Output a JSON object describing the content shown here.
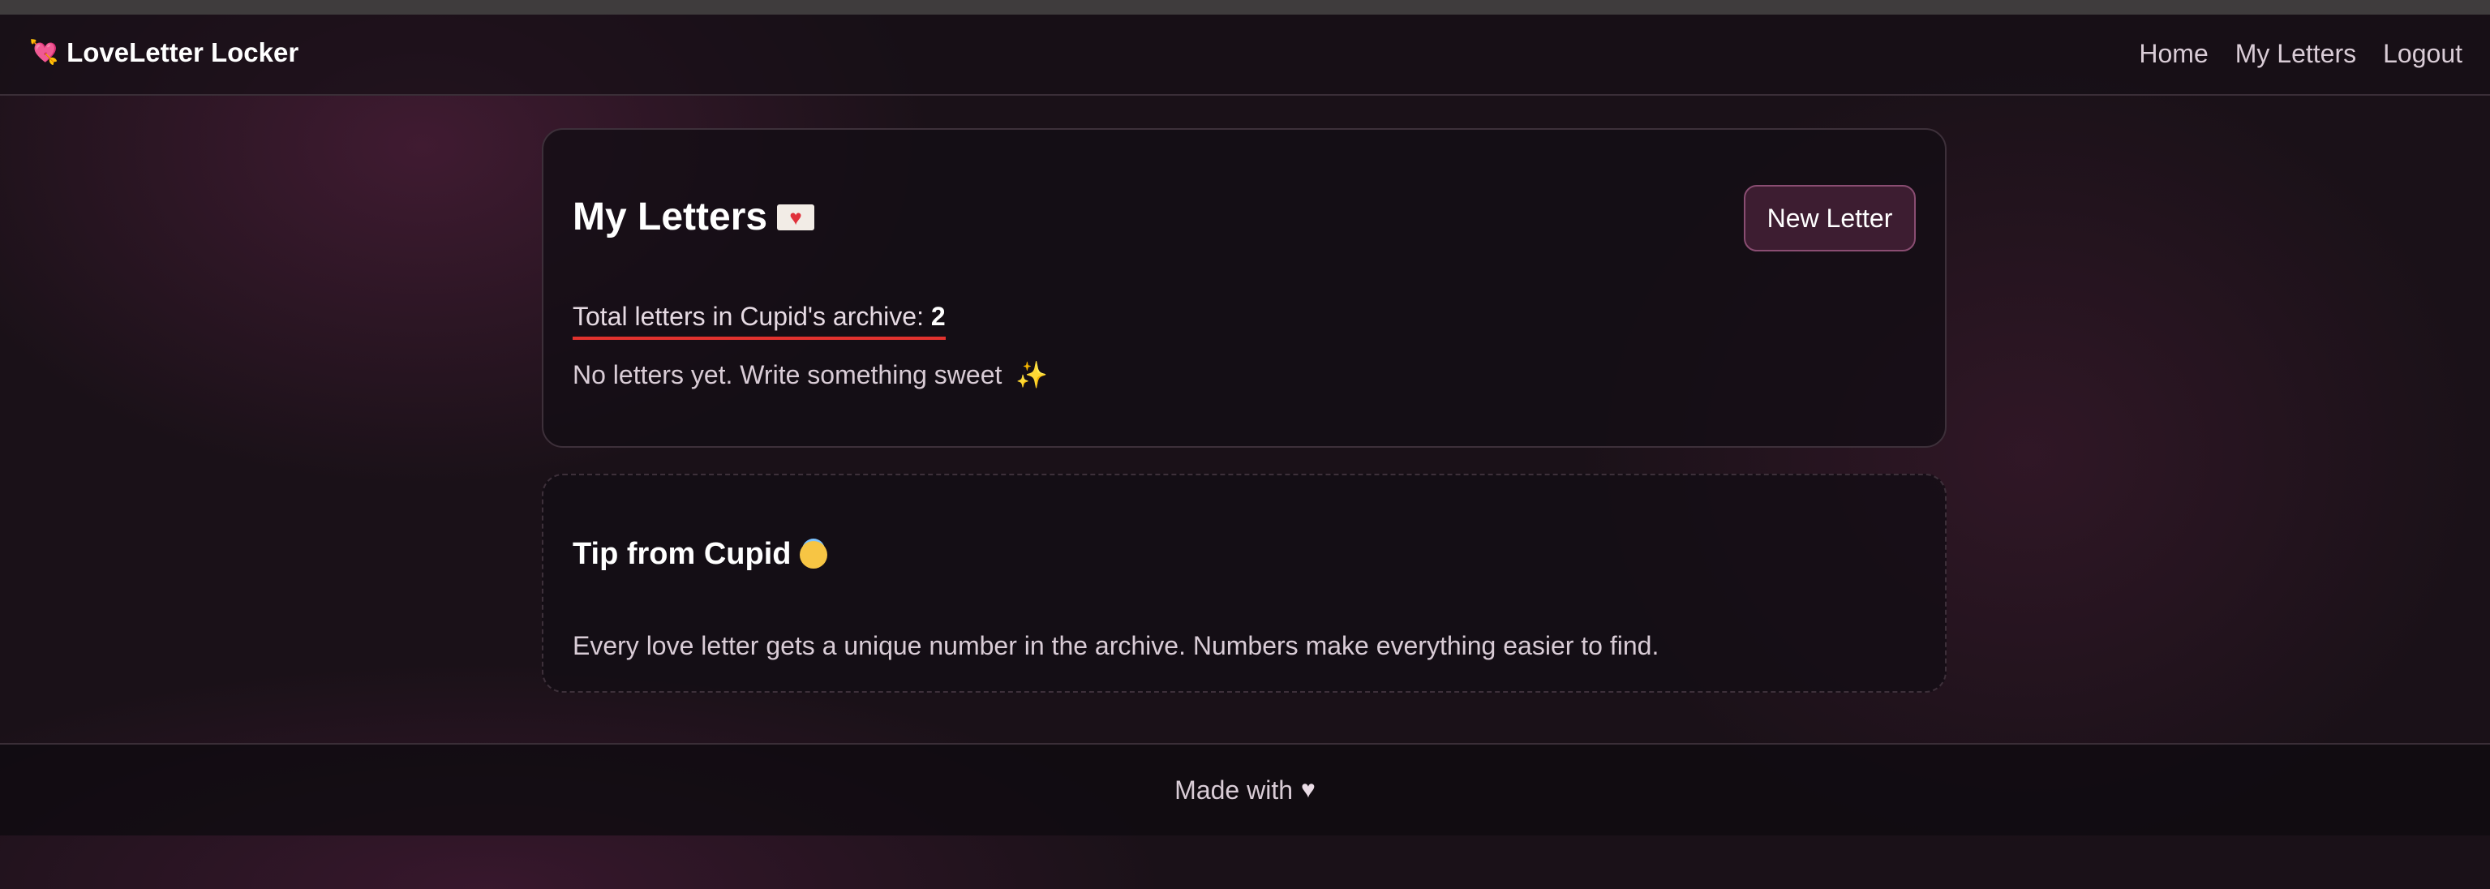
{
  "navbar": {
    "brand_icon": "heart-with-arrow-icon",
    "brand": "LoveLetter Locker",
    "links": [
      "Home",
      "My Letters",
      "Logout"
    ]
  },
  "main_card": {
    "title": "My Letters",
    "title_icon": "love-letter-envelope-icon",
    "new_letter_label": "New Letter",
    "total_label": "Total letters in Cupid's archive:",
    "total_count": "2",
    "empty_message": "No letters yet. Write something sweet",
    "empty_icon": "sparkles-icon"
  },
  "tip_card": {
    "title": "Tip from Cupid",
    "title_icon": "smiling-face-with-halo-icon",
    "text": "Every love letter gets a unique number in the archive. Numbers make everything easier to find."
  },
  "footer": {
    "text": "Made with",
    "icon": "heart-icon"
  },
  "colors": {
    "background": "#1a1118",
    "accent_button_bg": "#3d1d31",
    "accent_button_border": "#8a4d72",
    "underline": "#e2322e",
    "brand_icon": "#e94f9a"
  }
}
